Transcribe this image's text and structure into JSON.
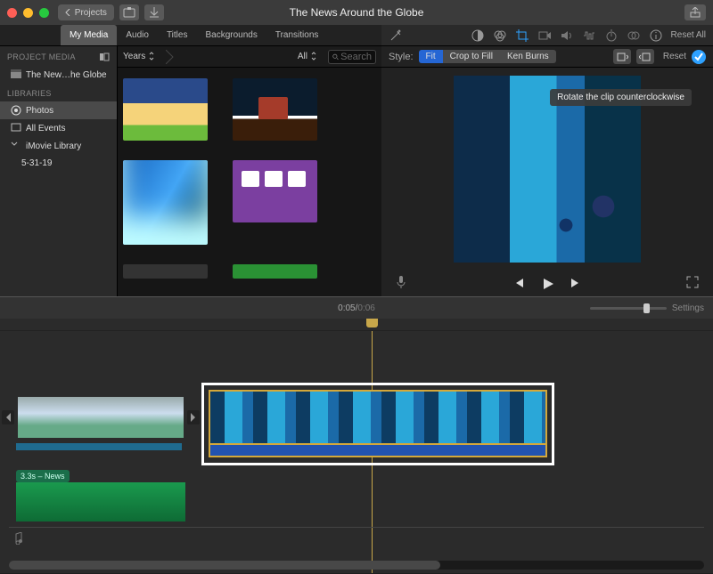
{
  "window": {
    "title": "The News Around the Globe"
  },
  "toolbar": {
    "back_label": "Projects"
  },
  "tabs": {
    "my_media": "My Media",
    "audio": "Audio",
    "titles": "Titles",
    "backgrounds": "Backgrounds",
    "transitions": "Transitions"
  },
  "sidebar": {
    "project_media_hdr": "PROJECT MEDIA",
    "project_item": "The New…he Globe",
    "libraries_hdr": "LIBRARIES",
    "photos": "Photos",
    "all_events": "All Events",
    "imovie_library": "iMovie Library",
    "date_item": "5-31-19"
  },
  "browser": {
    "breadcrumb": "Years",
    "filter_all": "All",
    "search_placeholder": "Search"
  },
  "adjust": {
    "reset": "Reset All"
  },
  "style": {
    "label": "Style:",
    "fit": "Fit",
    "crop_to_fill": "Crop to Fill",
    "ken_burns": "Ken Burns",
    "reset": "Reset"
  },
  "tooltip": {
    "rotate_ccw": "Rotate the clip counterclockwise"
  },
  "timecode": {
    "current": "0:05",
    "total": "0:06",
    "separator": " / "
  },
  "settings": {
    "label": "Settings"
  },
  "timeline": {
    "title_clip": "3.3s – News"
  }
}
